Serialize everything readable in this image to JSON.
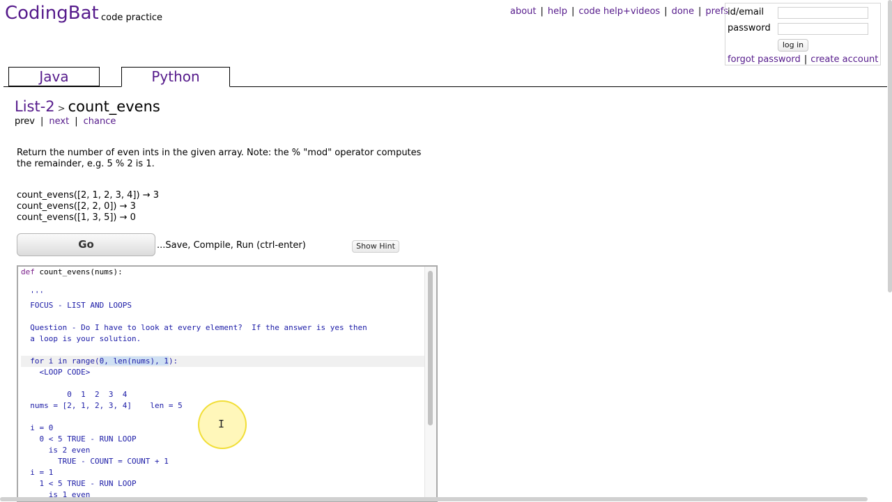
{
  "header": {
    "logo": "CodingBat",
    "tagline": "code practice",
    "nav": [
      "about",
      "help",
      "code help+videos",
      "done",
      "prefs"
    ]
  },
  "login": {
    "id_label": "id/email",
    "password_label": "password",
    "id_value": "",
    "password_value": "",
    "login_button": "log in",
    "forgot_link": "forgot password",
    "create_link": "create account"
  },
  "tabs": {
    "java": "Java",
    "python": "Python"
  },
  "crumb": {
    "section": "List-2",
    "sep": ">",
    "problem": "count_evens"
  },
  "subnav": {
    "prev": "prev",
    "next": "next",
    "chance": "chance"
  },
  "description": "Return the number of even ints in the given array. Note: the % \"mod\" operator computes the remainder, e.g. 5 % 2 is 1.",
  "examples": [
    "count_evens([2, 1, 2, 3, 4]) → 3",
    "count_evens([2, 2, 0]) → 3",
    "count_evens([1, 3, 5]) → 0"
  ],
  "actions": {
    "go": "Go",
    "go_label": "...Save, Compile, Run (ctrl-enter)",
    "hint": "Show Hint"
  },
  "code": {
    "def_kw": "def",
    "def_rest": " count_evens(nums):",
    "lines": [
      "",
      "  '''",
      "  FOCUS - LIST AND LOOPS",
      "",
      "  Question - Do I have to look at every element?  If the answer is yes then",
      "  a loop is your solution.",
      "",
      "__FOR__",
      "    <LOOP CODE>",
      "",
      "          0  1  2  3  4",
      "  nums = [2, 1, 2, 3, 4]    len = 5",
      "",
      "  i = 0",
      "    0 < 5 TRUE - RUN LOOP",
      "      is 2 even",
      "        TRUE - COUNT = COUNT + 1",
      "  i = 1",
      "    1 < 5 TRUE - RUN LOOP",
      "      is 1 even"
    ],
    "for_pre": "  for i in range(",
    "for_sel": "0, len(nums), 1",
    "for_post": "):"
  }
}
